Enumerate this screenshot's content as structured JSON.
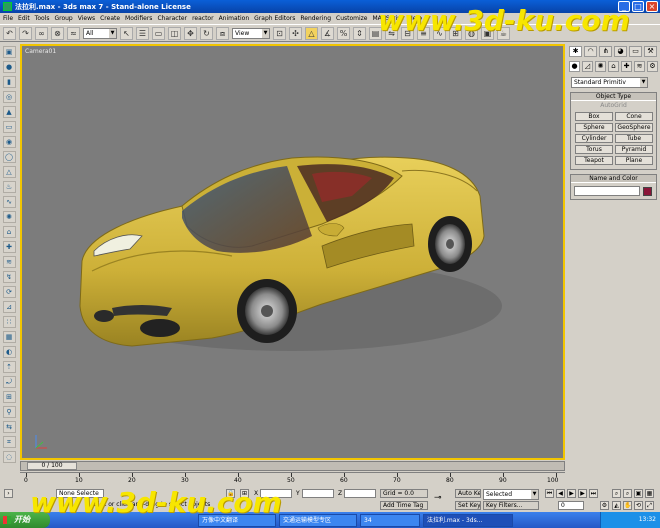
{
  "window": {
    "title": "法拉利.max - 3ds max 7 - Stand-alone License",
    "buttons": [
      "_",
      "□",
      "×"
    ]
  },
  "menu": [
    "File",
    "Edit",
    "Tools",
    "Group",
    "Views",
    "Create",
    "Modifiers",
    "Character",
    "reactor",
    "Animation",
    "Graph Editors",
    "Rendering",
    "Customize",
    "MAXScript",
    "Help"
  ],
  "toolbar": {
    "selection_filter": "All",
    "reference_coord": "View"
  },
  "viewport": {
    "label": "Camera01",
    "car_color": "#d6b93e",
    "background": "#7c7c7c",
    "border_color": "#f2c500"
  },
  "command_panel": {
    "category": "Standard Primitiv",
    "object_type": {
      "header": "Object Type",
      "autogrid": "AutoGrid",
      "buttons": [
        "Box",
        "Cone",
        "Sphere",
        "GeoSphere",
        "Cylinder",
        "Tube",
        "Torus",
        "Pyramid",
        "Teapot",
        "Plane"
      ]
    },
    "name_color": {
      "header": "Name and Color",
      "color": "#8a1538"
    }
  },
  "timeline": {
    "slider_label": "0 / 100",
    "ticks": [
      "0",
      "10",
      "20",
      "30",
      "40",
      "50",
      "60",
      "70",
      "80",
      "90",
      "100"
    ]
  },
  "status": {
    "selection": "None Selecte",
    "prompt": "Click or click-and-drag to select objects",
    "x_label": "X",
    "y_label": "Y",
    "z_label": "Z",
    "grid": "Grid = 0.0",
    "add_time_tag": "Add Time Tag",
    "auto_key": "Auto Key",
    "set_key": "Set Key",
    "selected": "Selected",
    "key_filters": "Key Filters...",
    "frame": "0"
  },
  "taskbar": {
    "start": "开始",
    "tasks": [
      "万像中文翻译",
      "交通运输模型专区",
      "34",
      "法拉利.max - 3ds..."
    ],
    "clock": "13:32"
  },
  "watermarks": [
    "www.3d-ku.com",
    "www.3d-ku.com"
  ]
}
